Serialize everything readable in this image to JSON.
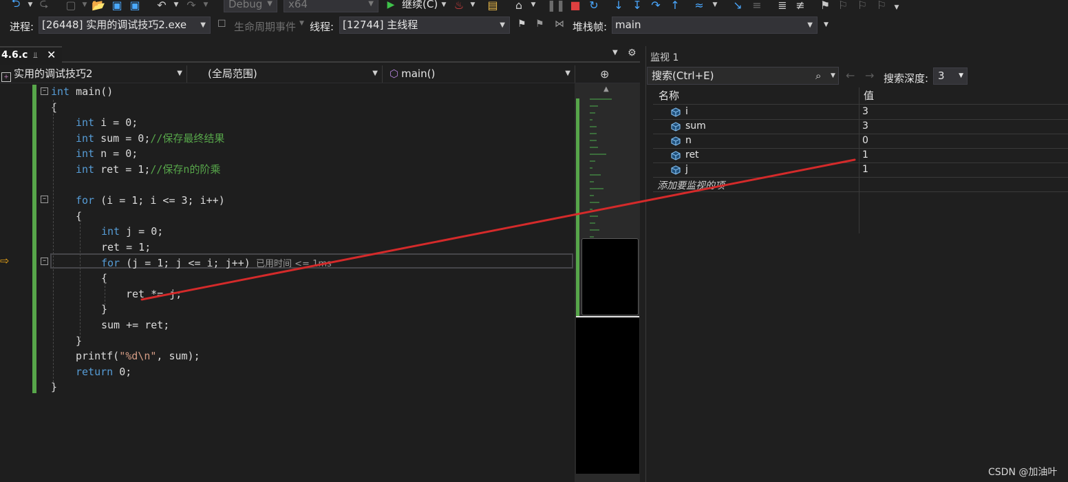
{
  "toolbar": {
    "configuration": "Debug",
    "platform": "x64",
    "continue_label": "继续(C)"
  },
  "debug_bar": {
    "process_label": "进程:",
    "process_value": "[26448] 实用的调试技巧2.exe",
    "lifecycle_label": "生命周期事件",
    "thread_label": "线程:",
    "thread_value": "[12744] 主线程",
    "stack_label": "堆栈帧:",
    "stack_value": "main"
  },
  "editor": {
    "tab_title": "4.6.c",
    "nav_project": "实用的调试技巧2",
    "nav_scope": "(全局范围)",
    "nav_function": "main()",
    "perf_tip": "已用时间 <= 1ms",
    "code": [
      {
        "indent": 0,
        "tokens": [
          {
            "t": "int",
            "c": "kw"
          },
          {
            "t": " main()",
            "c": "pl"
          }
        ]
      },
      {
        "indent": 0,
        "tokens": [
          {
            "t": "{",
            "c": "pl"
          }
        ]
      },
      {
        "indent": 1,
        "tokens": [
          {
            "t": "int",
            "c": "kw"
          },
          {
            "t": " i = 0;",
            "c": "pl"
          }
        ]
      },
      {
        "indent": 1,
        "tokens": [
          {
            "t": "int",
            "c": "kw"
          },
          {
            "t": " sum = 0;",
            "c": "pl"
          },
          {
            "t": "//保存最终结果",
            "c": "cm"
          }
        ]
      },
      {
        "indent": 1,
        "tokens": [
          {
            "t": "int",
            "c": "kw"
          },
          {
            "t": " n = 0;",
            "c": "pl"
          }
        ]
      },
      {
        "indent": 1,
        "tokens": [
          {
            "t": "int",
            "c": "kw"
          },
          {
            "t": " ret = 1;",
            "c": "pl"
          },
          {
            "t": "//保存n的阶乘",
            "c": "cm"
          }
        ]
      },
      {
        "indent": 1,
        "tokens": []
      },
      {
        "indent": 1,
        "tokens": [
          {
            "t": "for",
            "c": "kw"
          },
          {
            "t": " (i = 1; i <= 3; i++)",
            "c": "pl"
          }
        ]
      },
      {
        "indent": 1,
        "tokens": [
          {
            "t": "{",
            "c": "pl"
          }
        ]
      },
      {
        "indent": 2,
        "tokens": [
          {
            "t": "int",
            "c": "kw"
          },
          {
            "t": " j = 0;",
            "c": "pl"
          }
        ]
      },
      {
        "indent": 2,
        "tokens": [
          {
            "t": "ret = 1;",
            "c": "pl"
          }
        ]
      },
      {
        "indent": 2,
        "tokens": [
          {
            "t": "for",
            "c": "kw"
          },
          {
            "t": " (j = 1; j <= i; j++)",
            "c": "pl"
          }
        ]
      },
      {
        "indent": 2,
        "tokens": [
          {
            "t": "{",
            "c": "pl"
          }
        ]
      },
      {
        "indent": 3,
        "tokens": [
          {
            "t": "ret *= j;",
            "c": "pl"
          }
        ]
      },
      {
        "indent": 2,
        "tokens": [
          {
            "t": "}",
            "c": "pl"
          }
        ]
      },
      {
        "indent": 2,
        "tokens": [
          {
            "t": "sum += ret;",
            "c": "pl"
          }
        ]
      },
      {
        "indent": 1,
        "tokens": [
          {
            "t": "}",
            "c": "pl"
          }
        ]
      },
      {
        "indent": 1,
        "tokens": [
          {
            "t": "printf(",
            "c": "pl"
          },
          {
            "t": "\"%d\\n\"",
            "c": "str"
          },
          {
            "t": ", sum);",
            "c": "pl"
          }
        ]
      },
      {
        "indent": 1,
        "tokens": [
          {
            "t": "return",
            "c": "kw"
          },
          {
            "t": " 0;",
            "c": "pl"
          }
        ]
      },
      {
        "indent": 0,
        "tokens": [
          {
            "t": "}",
            "c": "pl"
          }
        ]
      }
    ]
  },
  "watch": {
    "title": "监视 1",
    "search_placeholder": "搜索(Ctrl+E)",
    "depth_label": "搜索深度:",
    "depth_value": "3",
    "col_name": "名称",
    "col_value": "值",
    "rows": [
      {
        "name": "i",
        "value": "3"
      },
      {
        "name": "sum",
        "value": "3"
      },
      {
        "name": "n",
        "value": "0"
      },
      {
        "name": "ret",
        "value": "1"
      },
      {
        "name": "j",
        "value": "1"
      }
    ],
    "add_item": "添加要监视的项"
  },
  "watermark": "CSDN @加油叶",
  "icons": {
    "back": "back-icon",
    "continue": "play-icon",
    "variable": "variable-cube-icon"
  },
  "colors": {
    "keyword": "#569cd6",
    "comment": "#57a64a",
    "annotation": "#d42a2a"
  }
}
